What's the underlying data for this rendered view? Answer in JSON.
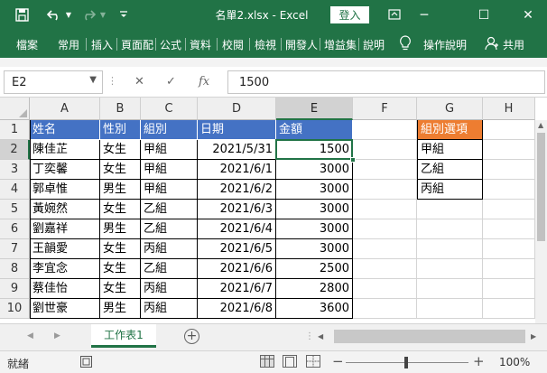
{
  "title_bar": {
    "title": "名單2.xlsx  -  Excel",
    "login_label": "登入",
    "minimize": "─",
    "restore": "☐",
    "close": "✕"
  },
  "ribbon": {
    "tabs": [
      "檔案",
      "常用",
      "插入",
      "頁面配",
      "公式",
      "資料",
      "校閱",
      "檢視",
      "開發人",
      "增益集",
      "說明"
    ],
    "tell_me": "操作說明",
    "share": "共用"
  },
  "formula_bar": {
    "name_box": "E2",
    "formula": "1500",
    "fx": "fx"
  },
  "grid": {
    "columns": [
      "A",
      "B",
      "C",
      "D",
      "E",
      "F",
      "G",
      "H"
    ],
    "rows": [
      "1",
      "2",
      "3",
      "4",
      "5",
      "6",
      "7",
      "8",
      "9",
      "10"
    ],
    "headers": [
      "姓名",
      "性別",
      "組別",
      "日期",
      "金額"
    ],
    "data": [
      [
        "陳佳芷",
        "女生",
        "甲組",
        "2021/5/31",
        "1500"
      ],
      [
        "丁奕馨",
        "女生",
        "甲組",
        "2021/6/1",
        "3000"
      ],
      [
        "郭卓惟",
        "男生",
        "甲組",
        "2021/6/2",
        "3000"
      ],
      [
        "黃婉然",
        "女生",
        "乙組",
        "2021/6/3",
        "3000"
      ],
      [
        "劉嘉祥",
        "男生",
        "乙組",
        "2021/6/4",
        "3000"
      ],
      [
        "王韻愛",
        "女生",
        "丙組",
        "2021/6/5",
        "3000"
      ],
      [
        "李宜念",
        "女生",
        "乙組",
        "2021/6/6",
        "2500"
      ],
      [
        "蔡佳怡",
        "女生",
        "丙組",
        "2021/6/7",
        "2800"
      ],
      [
        "劉世豪",
        "男生",
        "丙組",
        "2021/6/8",
        "3600"
      ]
    ],
    "options_header": "組別選項",
    "options": [
      "甲組",
      "乙組",
      "丙組"
    ],
    "selected_cell": "E2"
  },
  "sheet_tabs": {
    "active": "工作表1",
    "add": "+"
  },
  "status_bar": {
    "status": "就緒",
    "zoom": "100%"
  },
  "colors": {
    "excel_green": "#217346",
    "header_blue": "#4472c4",
    "header_orange": "#ed7d31"
  }
}
